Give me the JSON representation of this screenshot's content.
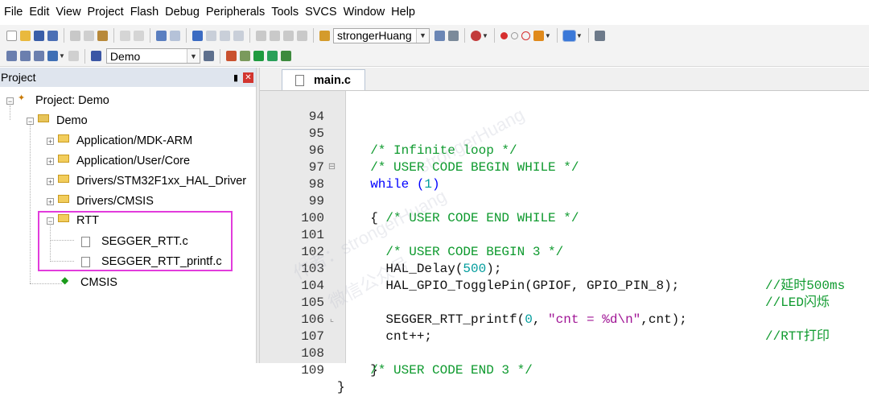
{
  "menu": [
    "File",
    "Edit",
    "View",
    "Project",
    "Flash",
    "Debug",
    "Peripherals",
    "Tools",
    "SVCS",
    "Window",
    "Help"
  ],
  "toolbar": {
    "find_text": "strongerHuang",
    "target": "Demo"
  },
  "project_panel": {
    "title": "Project",
    "tree": [
      {
        "label": "Project: Demo",
        "depth": 0,
        "expanded": true,
        "type": "project"
      },
      {
        "label": "Demo",
        "depth": 1,
        "expanded": true,
        "type": "target"
      },
      {
        "label": "Application/MDK-ARM",
        "depth": 2,
        "expanded": false,
        "type": "folder"
      },
      {
        "label": "Application/User/Core",
        "depth": 2,
        "expanded": false,
        "type": "folder"
      },
      {
        "label": "Drivers/STM32F1xx_HAL_Driver",
        "depth": 2,
        "expanded": false,
        "type": "folder"
      },
      {
        "label": "Drivers/CMSIS",
        "depth": 2,
        "expanded": false,
        "type": "folder"
      },
      {
        "label": "RTT",
        "depth": 2,
        "expanded": true,
        "type": "folder"
      },
      {
        "label": "SEGGER_RTT.c",
        "depth": 3,
        "type": "file"
      },
      {
        "label": "SEGGER_RTT_printf.c",
        "depth": 3,
        "type": "file"
      },
      {
        "label": "CMSIS",
        "depth": 2,
        "type": "component"
      }
    ]
  },
  "editor": {
    "tab": "main.c",
    "lines": [
      {
        "n": "94",
        "code": ""
      },
      {
        "n": "95",
        "code": "  /* Infinite loop */"
      },
      {
        "n": "96",
        "code": "  /* USER CODE BEGIN WHILE */"
      },
      {
        "n": "97",
        "code": "  while (1)"
      },
      {
        "n": "98",
        "code": "  {"
      },
      {
        "n": "99",
        "code": "    /* USER CODE END WHILE */"
      },
      {
        "n": "100",
        "code": ""
      },
      {
        "n": "101",
        "code": "    /* USER CODE BEGIN 3 */"
      },
      {
        "n": "102",
        "code": "    HAL_Delay(500);",
        "comment": "//延时500ms"
      },
      {
        "n": "103",
        "code": "    HAL_GPIO_TogglePin(GPIOF, GPIO_PIN_8);",
        "comment": "//LED闪烁"
      },
      {
        "n": "104",
        "code": ""
      },
      {
        "n": "105",
        "code": "    SEGGER_RTT_printf(0, \"cnt = %d\\n\",cnt);",
        "comment": "//RTT打印"
      },
      {
        "n": "106",
        "code": "    cnt++;"
      },
      {
        "n": "107",
        "code": "  }"
      },
      {
        "n": "108",
        "code": "  /* USER CODE END 3 */"
      },
      {
        "n": "109",
        "code": "}"
      }
    ]
  },
  "watermark": [
    "strongerHuang",
    "作者：strongerHuang",
    "微信公众号"
  ]
}
